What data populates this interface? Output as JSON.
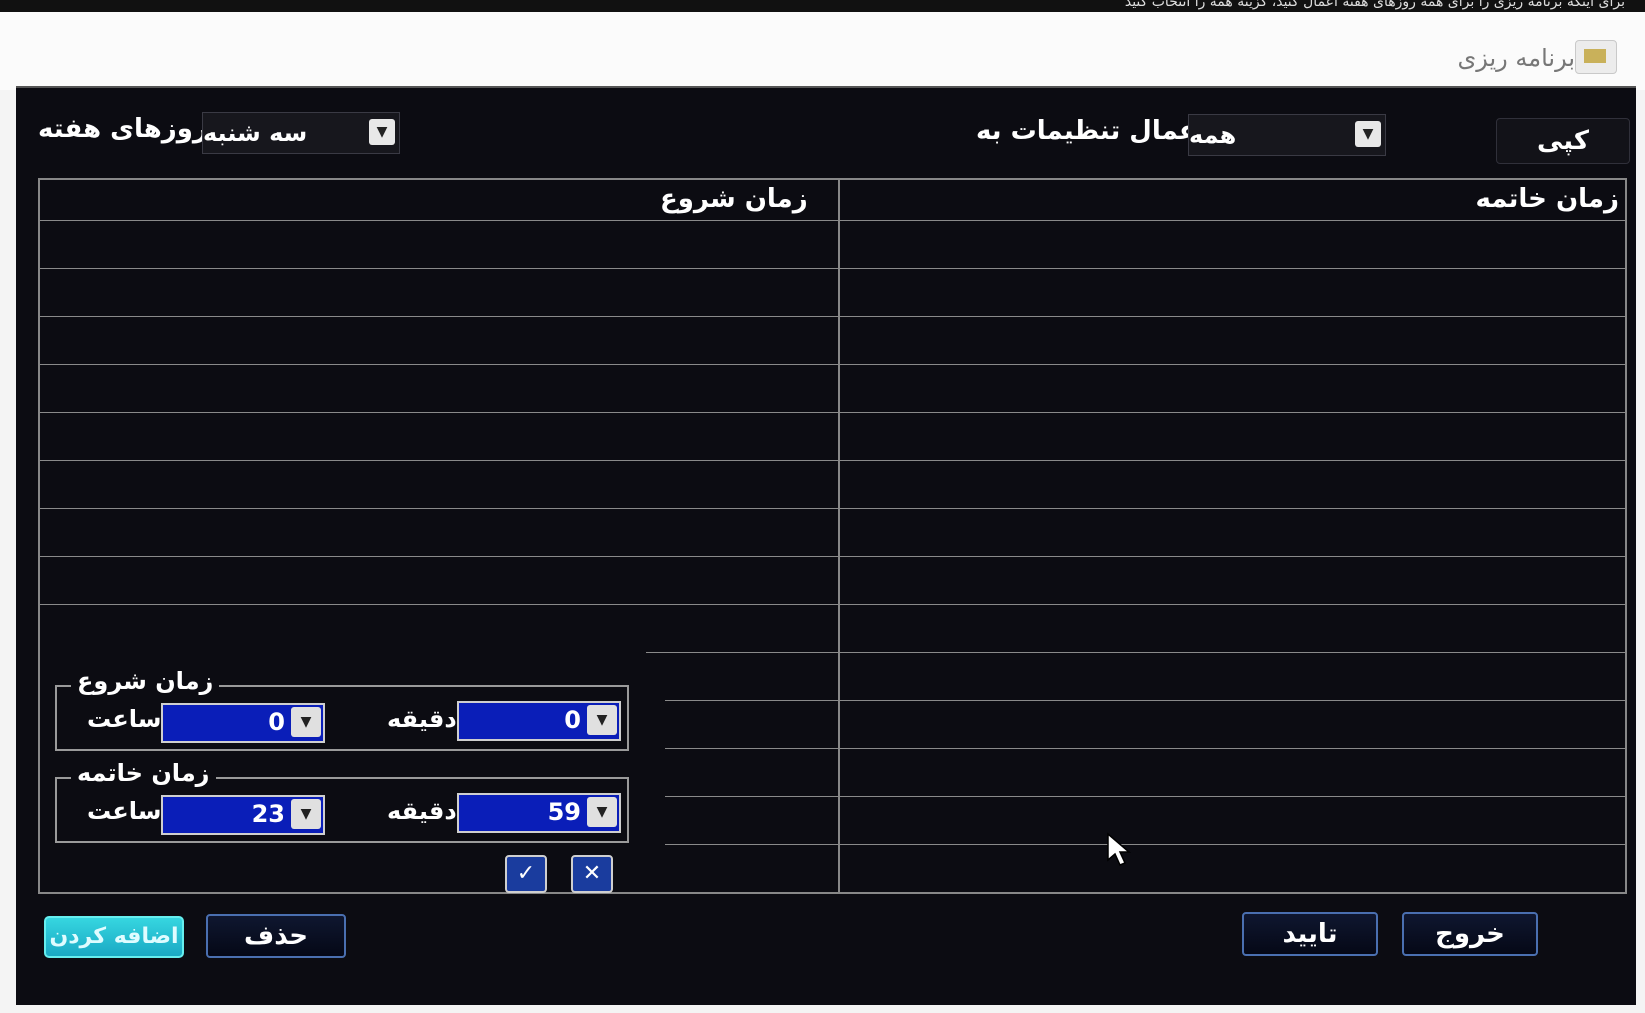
{
  "top_caption": "برای اینکه برنامه ریزی را برای همه روزهای هفته اعمال کنید، گزینه همه را انتخاب کنید",
  "header": {
    "title": "برنامه ریزی",
    "icon": "schedule-icon"
  },
  "toolbar": {
    "days_label": "روزهای هفته",
    "day_selected": "سه شنبه",
    "apply_label": "اعمال تنظیمات به",
    "apply_selected": "همه",
    "copy_label": "کپی"
  },
  "table": {
    "header_end": "زمان خاتمه",
    "header_start": "زمان شروع",
    "rows": 14
  },
  "time_editor": {
    "start_group": "زمان شروع",
    "end_group": "زمان خاتمه",
    "hour_label": "ساعت",
    "minute_label": "دقیقه",
    "start_hour": "0",
    "start_minute": "0",
    "end_hour": "23",
    "end_minute": "59"
  },
  "buttons": {
    "add": "اضافه کردن",
    "delete": "حذف",
    "confirm": "تایید",
    "exit": "خروج"
  },
  "colors": {
    "dialog_bg": "#0c0c12",
    "spin_bg": "#0a1eb8",
    "add_btn": "#1aa9c4",
    "button_border": "#4a6fb0"
  }
}
